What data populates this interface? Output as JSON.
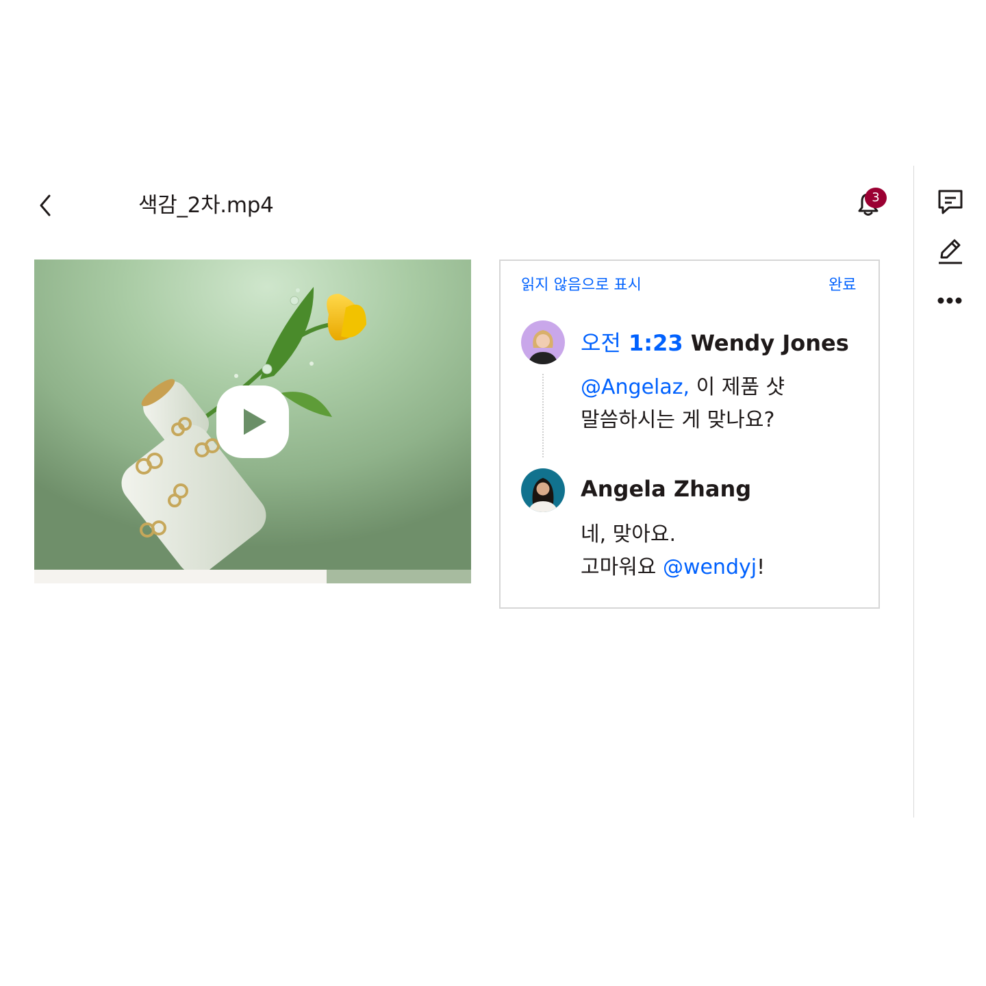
{
  "header": {
    "file_name": "색감_2차.mp4",
    "notification_count": "3"
  },
  "icons": {
    "back": "chevron-left-icon",
    "notifications": "bell-icon",
    "comments": "comment-icon",
    "edit": "pencil-icon",
    "more": "more-horizontal-icon",
    "play": "play-icon"
  },
  "video": {
    "progress_fraction": 0.67
  },
  "comments_panel": {
    "mark_unread_label": "읽지 않음으로 표시",
    "done_label": "완료",
    "comments": [
      {
        "time_prefix": "오전",
        "time": "1:23",
        "author": "Wendy Jones",
        "mention": "@Angelaz,",
        "line1_rest": " 이 제품 샷",
        "line2": "말씀하시는 게 맞나요?"
      },
      {
        "author": "Angela Zhang",
        "line1": "네, 맞아요.",
        "line2_prefix": "고마워요 ",
        "mention": "@wendyj",
        "line2_suffix": "!"
      }
    ]
  },
  "colors": {
    "accent": "#0061fe",
    "badge": "#9b0032",
    "text": "#1e1919"
  }
}
